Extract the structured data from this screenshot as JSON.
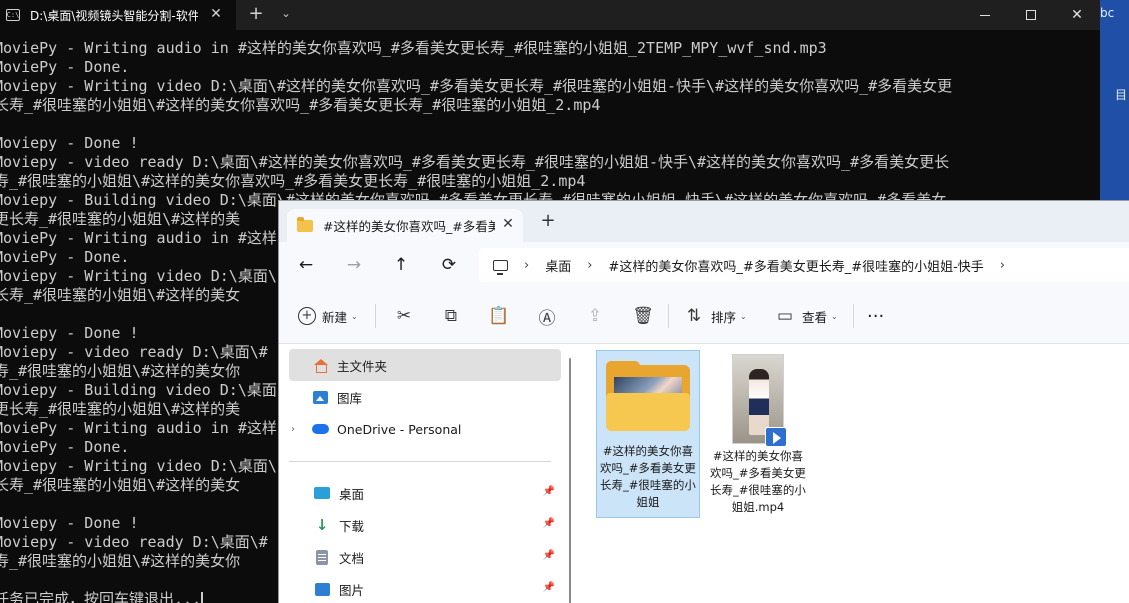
{
  "desktop": {
    "edge_text_top": "bc",
    "edge_text_mid": "目"
  },
  "terminal": {
    "tab_title": "D:\\桌面\\视频镜头智能分割-软件",
    "tab_icon": "C:\\",
    "close_tab": "✕",
    "new_tab": "+",
    "dropdown": "⌄",
    "lines": [
      "MoviePy - Writing audio in #这样的美女你喜欢吗_#多看美女更长寿_#很哇塞的小姐姐_2TEMP_MPY_wvf_snd.mp3",
      "MoviePy - Done.",
      "Moviepy - Writing video D:\\桌面\\#这样的美女你喜欢吗_#多看美女更长寿_#很哇塞的小姐姐-快手\\#这样的美女你喜欢吗_#多看美女更",
      "长寿_#很哇塞的小姐姐\\#这样的美女你喜欢吗_#多看美女更长寿_#很哇塞的小姐姐_2.mp4",
      "",
      "Moviepy - Done !",
      "Moviepy - video ready D:\\桌面\\#这样的美女你喜欢吗_#多看美女更长寿_#很哇塞的小姐姐-快手\\#这样的美女你喜欢吗_#多看美女更长",
      "寿_#很哇塞的小姐姐\\#这样的美女你喜欢吗_#多看美女更长寿_#很哇塞的小姐姐_2.mp4",
      "Moviepy - Building video D:\\桌面\\#这样的美女你喜欢吗_#多看美女更长寿_#很哇塞的小姐姐-快手\\#这样的美女你喜欢吗_#多看美女",
      "更长寿_#很哇塞的小姐姐\\#这样的美",
      "MoviePy - Writing audio in #这样",
      "MoviePy - Done.",
      "Moviepy - Writing video D:\\桌面\\",
      "长寿_#很哇塞的小姐姐\\#这样的美女",
      "",
      "Moviepy - Done !",
      "Moviepy - video ready D:\\桌面\\#",
      "寿_#很哇塞的小姐姐\\#这样的美女你",
      "Moviepy - Building video D:\\桌面",
      "更长寿_#很哇塞的小姐姐\\#这样的美",
      "MoviePy - Writing audio in #这样",
      "MoviePy - Done.",
      "Moviepy - Writing video D:\\桌面\\",
      "长寿_#很哇塞的小姐姐\\#这样的美女",
      "",
      "Moviepy - Done !",
      "Moviepy - video ready D:\\桌面\\#",
      "寿_#很哇塞的小姐姐\\#这样的美女你",
      "",
      "任务已完成，按回车键退出..."
    ]
  },
  "explorer": {
    "tab_title": "#这样的美女你喜欢吗_#多看美女更长寿_#很哇塞的小姐姐-快手",
    "tab_close": "✕",
    "new_tab": "+",
    "nav": {
      "back": "←",
      "forward": "→",
      "up": "↑",
      "refresh": "⟳"
    },
    "breadcrumb": {
      "sep": "›",
      "items": [
        "桌面",
        "#这样的美女你喜欢吗_#多看美女更长寿_#很哇塞的小姐姐-快手"
      ]
    },
    "toolbar": {
      "new_label": "新建",
      "sort_label": "排序",
      "view_label": "查看",
      "chevron": "⌄",
      "more": "···",
      "icons": {
        "cut": "✂",
        "copy": "⧉",
        "paste": "📋",
        "rename": "Ⓐ",
        "share": "⇪",
        "delete": "🗑",
        "sort": "⇅",
        "view": "▭"
      }
    },
    "sidebar": {
      "items": [
        {
          "label": "主文件夹",
          "icon": "home-icon",
          "selected": true
        },
        {
          "label": "图库",
          "icon": "gallery-icon"
        },
        {
          "label": "OneDrive - Personal",
          "icon": "cloud-icon"
        },
        {
          "label": "桌面",
          "icon": "desktop-icon",
          "pinned": true
        },
        {
          "label": "下载",
          "icon": "download-icon",
          "pinned": true
        },
        {
          "label": "文档",
          "icon": "document-icon",
          "pinned": true
        },
        {
          "label": "图片",
          "icon": "pictures-icon",
          "pinned": true
        }
      ],
      "expander": "›",
      "pin": "📌",
      "download_glyph": "↓"
    },
    "files": [
      {
        "name": "#这样的美女你喜欢吗_#多看美女更长寿_#很哇塞的小姐姐",
        "type": "folder",
        "selected": true
      },
      {
        "name": "#这样的美女你喜欢吗_#多看美女更长寿_#很哇塞的小姐姐.mp4",
        "type": "video"
      }
    ]
  }
}
